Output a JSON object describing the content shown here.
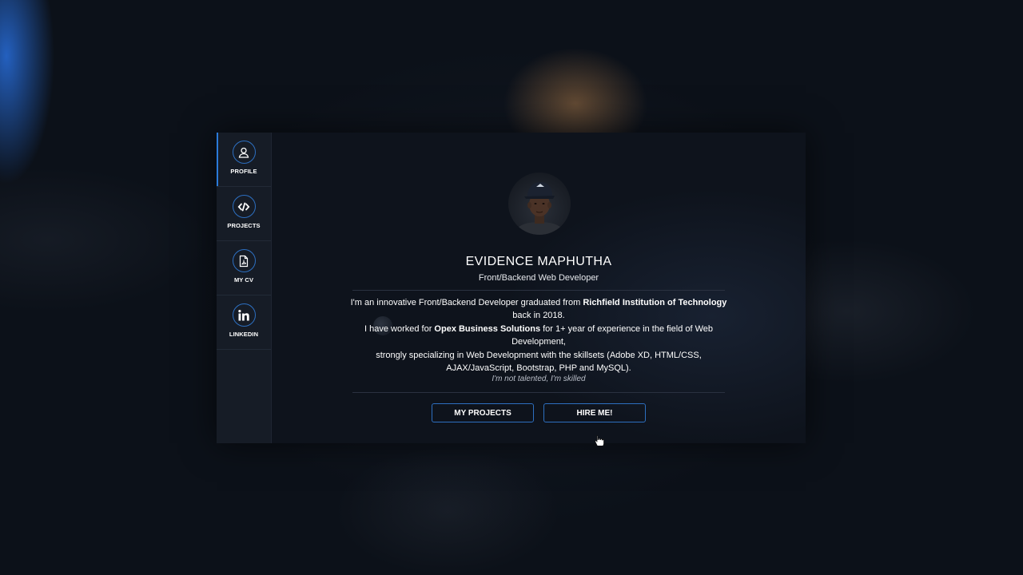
{
  "sidebar": {
    "items": [
      {
        "label": "PROFILE",
        "icon": "user-icon",
        "active": true
      },
      {
        "label": "PROJECTS",
        "icon": "code-icon",
        "active": false
      },
      {
        "label": "MY CV",
        "icon": "pdf-icon",
        "active": false
      },
      {
        "label": "LINKEDIN",
        "icon": "linkedin-icon",
        "active": false
      }
    ]
  },
  "profile": {
    "name": "EVIDENCE MAPHUTHA",
    "role": "Front/Backend Web Developer",
    "bio": {
      "line1_pre": "I'm an innovative Front/Backend Developer graduated from ",
      "line1_bold": "Richfield Institution of Technology",
      "line2": "back in 2018.",
      "line3_pre": "I have worked for ",
      "line3_bold": "Opex Business Solutions",
      "line3_post": " for 1+ year of experience in the field of Web",
      "line4": "Development,",
      "line5": "strongly specializing in Web Development with the skillsets (Adobe XD, HTML/CSS,",
      "line6": "AJAX/JavaScript, Bootstrap, PHP and MySQL)."
    },
    "quote": "I'm not talented,  I'm skilled"
  },
  "actions": {
    "projects_label": "MY PROJECTS",
    "hire_label": "HIRE ME!"
  },
  "colors": {
    "accent": "#2d6fc0",
    "sidebar_bg": "#161c26",
    "card_bg": "#0e131c"
  }
}
